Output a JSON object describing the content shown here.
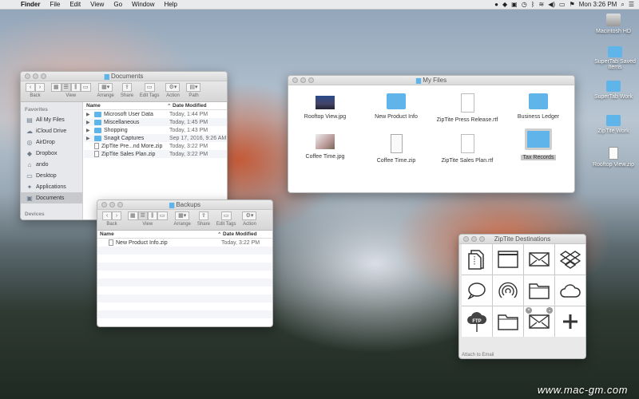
{
  "menubar": {
    "app": "Finder",
    "items": [
      "File",
      "Edit",
      "View",
      "Go",
      "Window",
      "Help"
    ],
    "clock": "Mon 3:26 PM"
  },
  "desktop_icons": [
    {
      "label": "Macintosh HD",
      "icon": "hard-drive-icon"
    },
    {
      "label": "SuperTab Saved Items",
      "icon": "folder-icon"
    },
    {
      "label": "SuperTab Work",
      "icon": "folder-icon"
    },
    {
      "label": "ZipTite Work",
      "icon": "folder-icon"
    },
    {
      "label": "Rooftop View.zip",
      "icon": "zip-file-icon"
    }
  ],
  "documents_window": {
    "title": "Documents",
    "toolbar": {
      "back": "Back",
      "view": "View",
      "arrange": "Arrange",
      "share": "Share",
      "edit_tags": "Edit Tags",
      "action": "Action",
      "path": "Path"
    },
    "sidebar": {
      "favorites_label": "Favorites",
      "items": [
        {
          "label": "All My Files",
          "icon": "all-files-icon"
        },
        {
          "label": "iCloud Drive",
          "icon": "cloud-icon"
        },
        {
          "label": "AirDrop",
          "icon": "airdrop-icon"
        },
        {
          "label": "Dropbox",
          "icon": "dropbox-icon"
        },
        {
          "label": "ando",
          "icon": "home-icon"
        },
        {
          "label": "Desktop",
          "icon": "desktop-icon"
        },
        {
          "label": "Applications",
          "icon": "applications-icon"
        },
        {
          "label": "Documents",
          "icon": "documents-icon",
          "selected": true
        }
      ],
      "devices_label": "Devices"
    },
    "columns": {
      "name": "Name",
      "date": "Date Modified"
    },
    "rows": [
      {
        "name": "Microsoft User Data",
        "date": "Today, 1:44 PM",
        "type": "folder"
      },
      {
        "name": "Miscellaneous",
        "date": "Today, 1:45 PM",
        "type": "folder"
      },
      {
        "name": "Shopping",
        "date": "Today, 1:43 PM",
        "type": "folder"
      },
      {
        "name": "Snagit Captures",
        "date": "Sep 17, 2016, 9:26 AM",
        "type": "folder"
      },
      {
        "name": "ZipTite Pre...nd More.zip",
        "date": "Today, 3:22 PM",
        "type": "zip"
      },
      {
        "name": "ZipTite Sales Plan.zip",
        "date": "Today, 3:22 PM",
        "type": "zip"
      }
    ]
  },
  "backups_window": {
    "title": "Backups",
    "toolbar": {
      "back": "Back",
      "view": "View",
      "arrange": "Arrange",
      "share": "Share",
      "edit_tags": "Edit Tags",
      "action": "Action"
    },
    "columns": {
      "name": "Name",
      "date": "Date Modified"
    },
    "rows": [
      {
        "name": "New Product Info.zip",
        "date": "Today, 3:22 PM",
        "type": "zip"
      }
    ]
  },
  "myfiles_window": {
    "title": "My Files",
    "items": [
      {
        "label": "Rooftop View.jpg",
        "type": "image"
      },
      {
        "label": "New Product Info",
        "type": "folder"
      },
      {
        "label": "ZipTite Press Release.rtf",
        "type": "doc"
      },
      {
        "label": "Business Ledger",
        "type": "folder"
      },
      {
        "label": "Coffee Time.jpg",
        "type": "image"
      },
      {
        "label": "Coffee Time.zip",
        "type": "zip"
      },
      {
        "label": "ZipTite Sales Plan.rtf",
        "type": "doc"
      },
      {
        "label": "Tax Records",
        "type": "folder",
        "selected": true
      }
    ]
  },
  "destinations_window": {
    "title": "ZipTite Destinations",
    "cells": [
      {
        "icon": "zip-document-icon"
      },
      {
        "icon": "window-icon"
      },
      {
        "icon": "mail-icon"
      },
      {
        "icon": "dropbox-icon"
      },
      {
        "icon": "message-bubble-icon"
      },
      {
        "icon": "airdrop-icon"
      },
      {
        "icon": "folder-outline-icon"
      },
      {
        "icon": "cloud-outline-icon"
      },
      {
        "icon": "ftp-cloud-icon"
      },
      {
        "icon": "folder-outline-icon"
      },
      {
        "icon": "mail-icon"
      },
      {
        "icon": "plus-icon"
      }
    ],
    "footer": "Attach to Email"
  },
  "watermark": "www.mac-gm.com"
}
